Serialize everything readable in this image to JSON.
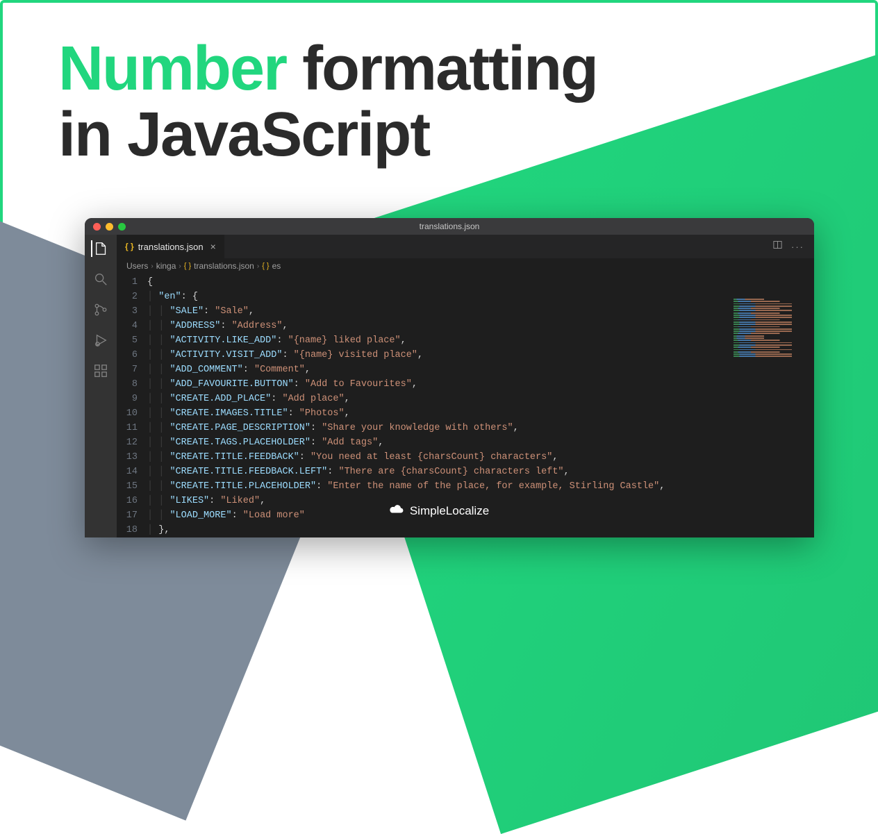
{
  "headline": {
    "accent": "Number",
    "rest1": "formatting",
    "rest2": "in JavaScript"
  },
  "window": {
    "title": "translations.json"
  },
  "tab": {
    "filename": "translations.json"
  },
  "breadcrumbs": {
    "seg1": "Users",
    "seg2": "kinga",
    "seg3": "translations.json",
    "seg4": "es"
  },
  "brand": "SimpleLocalize",
  "code": {
    "lines": [
      {
        "n": "1",
        "indent": 0,
        "raw": "{"
      },
      {
        "n": "2",
        "indent": 1,
        "key": "\"en\"",
        "after": ": {"
      },
      {
        "n": "3",
        "indent": 2,
        "key": "\"SALE\"",
        "sep": ": ",
        "str": "\"Sale\"",
        "tail": ","
      },
      {
        "n": "4",
        "indent": 2,
        "key": "\"ADDRESS\"",
        "sep": ": ",
        "str": "\"Address\"",
        "tail": ","
      },
      {
        "n": "5",
        "indent": 2,
        "key": "\"ACTIVITY.LIKE_ADD\"",
        "sep": ": ",
        "str": "\"{name} liked place\"",
        "tail": ","
      },
      {
        "n": "6",
        "indent": 2,
        "key": "\"ACTIVITY.VISIT_ADD\"",
        "sep": ": ",
        "str": "\"{name} visited place\"",
        "tail": ","
      },
      {
        "n": "7",
        "indent": 2,
        "key": "\"ADD_COMMENT\"",
        "sep": ": ",
        "str": "\"Comment\"",
        "tail": ","
      },
      {
        "n": "8",
        "indent": 2,
        "key": "\"ADD_FAVOURITE.BUTTON\"",
        "sep": ": ",
        "str": "\"Add to Favourites\"",
        "tail": ","
      },
      {
        "n": "9",
        "indent": 2,
        "key": "\"CREATE.ADD_PLACE\"",
        "sep": ": ",
        "str": "\"Add place\"",
        "tail": ","
      },
      {
        "n": "10",
        "indent": 2,
        "key": "\"CREATE.IMAGES.TITLE\"",
        "sep": ": ",
        "str": "\"Photos\"",
        "tail": ","
      },
      {
        "n": "11",
        "indent": 2,
        "key": "\"CREATE.PAGE_DESCRIPTION\"",
        "sep": ": ",
        "str": "\"Share your knowledge with others\"",
        "tail": ","
      },
      {
        "n": "12",
        "indent": 2,
        "key": "\"CREATE.TAGS.PLACEHOLDER\"",
        "sep": ": ",
        "str": "\"Add tags\"",
        "tail": ","
      },
      {
        "n": "13",
        "indent": 2,
        "key": "\"CREATE.TITLE.FEEDBACK\"",
        "sep": ": ",
        "str": "\"You need at least {charsCount} characters\"",
        "tail": ","
      },
      {
        "n": "14",
        "indent": 2,
        "key": "\"CREATE.TITLE.FEEDBACK.LEFT\"",
        "sep": ": ",
        "str": "\"There are {charsCount} characters left\"",
        "tail": ","
      },
      {
        "n": "15",
        "indent": 2,
        "key": "\"CREATE.TITLE.PLACEHOLDER\"",
        "sep": ": ",
        "str": "\"Enter the name of the place, for example, Stirling Castle\"",
        "tail": ","
      },
      {
        "n": "16",
        "indent": 2,
        "key": "\"LIKES\"",
        "sep": ": ",
        "str": "\"Liked\"",
        "tail": ","
      },
      {
        "n": "17",
        "indent": 2,
        "key": "\"LOAD_MORE\"",
        "sep": ": ",
        "str": "\"Load more\"",
        "tail": ""
      },
      {
        "n": "18",
        "indent": 1,
        "raw": "},"
      }
    ]
  }
}
